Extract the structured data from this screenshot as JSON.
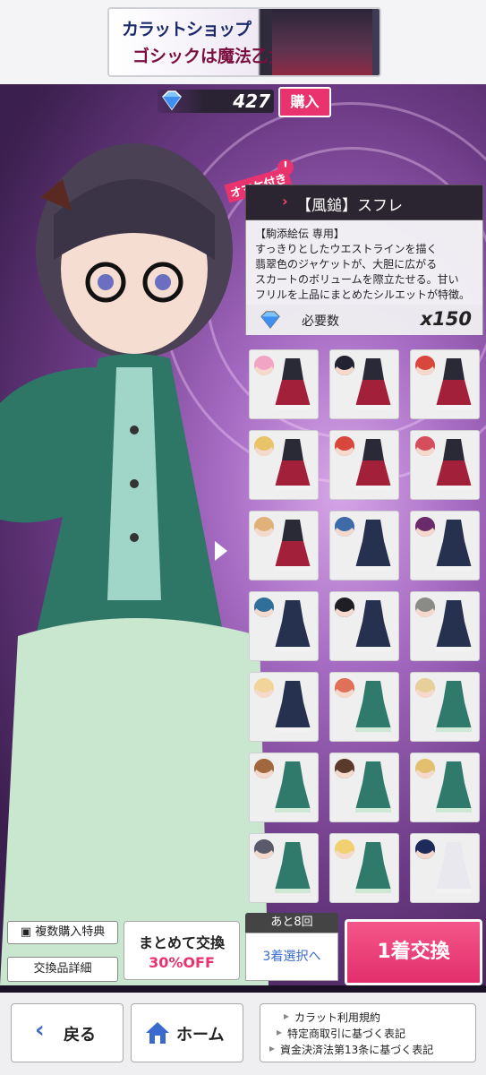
{
  "banner": {
    "title": "カラットショップ",
    "subtitle": "ゴシックは魔法乙女"
  },
  "currency": {
    "gem_icon": "blue-gem-icon",
    "count": "427",
    "buy_label": "購入"
  },
  "item": {
    "bonus_tag": "オマケ付き",
    "bonus_mark": "!",
    "chevron": "›",
    "name": "【風鎚】スフレ",
    "description": [
      "【駒添絵伝 専用】",
      "すっきりとしたウエストラインを描く",
      "翡翠色のジャケットが、大胆に広がる",
      "スカートのボリュームを際立たせる。甘い",
      "フリルを上品にまとめたシルエットが特徴。"
    ],
    "required_label": "必要数",
    "required_count": "x150"
  },
  "grid": {
    "cells": [
      {
        "hair": "#f2a4c4",
        "outfit": "red"
      },
      {
        "hair": "#222233",
        "outfit": "red"
      },
      {
        "hair": "#d9473c",
        "outfit": "red"
      },
      {
        "hair": "#e9c36a",
        "outfit": "red"
      },
      {
        "hair": "#d9473c",
        "outfit": "red"
      },
      {
        "hair": "#d64d5d",
        "outfit": "red"
      },
      {
        "hair": "#e0b27a",
        "outfit": "red"
      },
      {
        "hair": "#3f6aa8",
        "outfit": "navy"
      },
      {
        "hair": "#6a2b6a",
        "outfit": "navy"
      },
      {
        "hair": "#2f6f9a",
        "outfit": "navy"
      },
      {
        "hair": "#1e1e24",
        "outfit": "navy"
      },
      {
        "hair": "#8a8a86",
        "outfit": "navy"
      },
      {
        "hair": "#f0d49a",
        "outfit": "navy"
      },
      {
        "hair": "#e07058",
        "outfit": "green"
      },
      {
        "hair": "#e6cf98",
        "outfit": "green"
      },
      {
        "hair": "#a0683c",
        "outfit": "green"
      },
      {
        "hair": "#5a3a2a",
        "outfit": "green"
      },
      {
        "hair": "#e3c06e",
        "outfit": "green"
      },
      {
        "hair": "#5a5a6a",
        "outfit": "green"
      },
      {
        "hair": "#f0d070",
        "outfit": "green"
      },
      {
        "hair": "#1e2a5a",
        "outfit": "white"
      }
    ]
  },
  "actions": {
    "bulk_bonus_label": "複数購入特典",
    "details_label": "交換品詳細",
    "bulk_exchange_line1": "まとめて交換",
    "bulk_exchange_line2": "30%OFF",
    "remaining_label": "あと8回",
    "select_three_label": "3着選択へ",
    "exchange_one_label": "1着交換"
  },
  "footer": {
    "back_label": "戻る",
    "home_label": "ホーム",
    "links": [
      "カラット利用規約",
      "特定商取引に基づく表記",
      "資金決済法第13条に基づく表記"
    ]
  },
  "colors": {
    "accent": "#e8336e",
    "outfit_red": "#a3203a",
    "outfit_navy": "#26304f",
    "outfit_green": "#2f7a6a",
    "outfit_white": "#e8e8ee"
  }
}
